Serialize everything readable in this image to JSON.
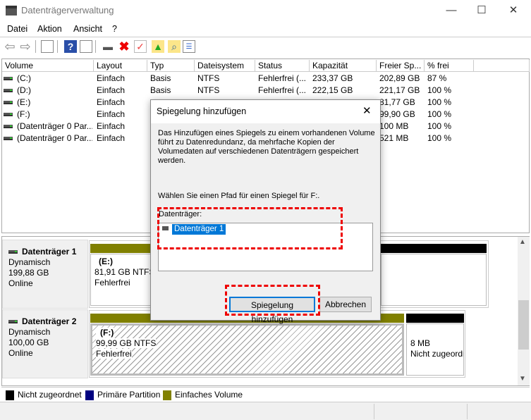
{
  "window": {
    "title": "Datenträgerverwaltung",
    "controls": [
      "—",
      "☐",
      "✕"
    ]
  },
  "menu": [
    "Datei",
    "Aktion",
    "Ansicht",
    "?"
  ],
  "toolbar": {
    "icons": [
      "back-icon",
      "forward-icon",
      "console-tree-icon",
      "help-icon",
      "action-pane-icon",
      "connect-disk-icon",
      "delete-icon",
      "properties-icon",
      "up-folder-icon",
      "search-folder-icon",
      "list-icon"
    ]
  },
  "volume_list": {
    "columns": [
      "Volume",
      "Layout",
      "Typ",
      "Dateisystem",
      "Status",
      "Kapazität",
      "Freier Sp...",
      "% frei"
    ],
    "rows": [
      [
        "(C:)",
        "Einfach",
        "Basis",
        "NTFS",
        "Fehlerfrei (...",
        "233,37 GB",
        "202,89 GB",
        "87 %"
      ],
      [
        "(D:)",
        "Einfach",
        "Basis",
        "NTFS",
        "Fehlerfrei (...",
        "222,15 GB",
        "221,17 GB",
        "100 %"
      ],
      [
        "(E:)",
        "Einfach",
        "",
        "",
        "",
        "",
        "81,77 GB",
        "100 %"
      ],
      [
        "(F:)",
        "Einfach",
        "",
        "",
        "",
        "",
        "99,90 GB",
        "100 %"
      ],
      [
        "(Datenträger 0 Par...",
        "Einfach",
        "",
        "",
        "",
        "",
        "100 MB",
        "100 %"
      ],
      [
        "(Datenträger 0 Par...",
        "Einfach",
        "",
        "",
        "",
        "",
        "521 MB",
        "100 %"
      ]
    ]
  },
  "disks": [
    {
      "name": "Datenträger 1",
      "type": "Dynamisch",
      "size": "199,88 GB",
      "state": "Online",
      "partition": {
        "label": "(E:)",
        "size": "81,91 GB NTFS",
        "status": "Fehlerfrei"
      }
    },
    {
      "name": "Datenträger 2",
      "type": "Dynamisch",
      "size": "100,00 GB",
      "state": "Online",
      "partition": {
        "label": "(F:)",
        "size": "99,99 GB NTFS",
        "status": "Fehlerfrei"
      },
      "unallocated": {
        "size": "8 MB",
        "status": "Nicht zugeordnet"
      }
    }
  ],
  "legend": [
    {
      "label": "Nicht zugeordnet",
      "color": "#000000"
    },
    {
      "label": "Primäre Partition",
      "color": "#000080"
    },
    {
      "label": "Einfaches Volume",
      "color": "#808000"
    }
  ],
  "dialog": {
    "title": "Spiegelung hinzufügen",
    "description": [
      "Das Hinzufügen eines Spiegels zu einem vorhandenen Volume",
      "führt zu Datenredundanz, da mehrfache Kopien der",
      "Volumedaten auf verschiedenen Datenträgern gespeichert",
      "werden."
    ],
    "prompt": "Wählen Sie einen Pfad für einen Spiegel für F:.",
    "list_label": "Datenträger:",
    "list_items": [
      "Datenträger 1"
    ],
    "selected": "Datenträger 1",
    "ok_label": "Spiegelung hinzufügen",
    "cancel_label": "Abbrechen",
    "close": "✕"
  }
}
